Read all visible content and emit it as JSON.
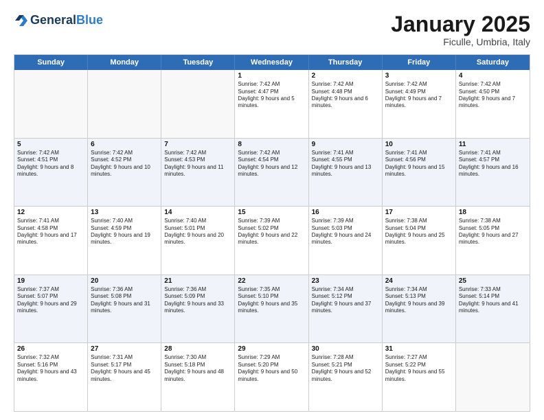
{
  "header": {
    "logo_general": "General",
    "logo_blue": "Blue",
    "month_title": "January 2025",
    "location": "Ficulle, Umbria, Italy"
  },
  "weekdays": [
    "Sunday",
    "Monday",
    "Tuesday",
    "Wednesday",
    "Thursday",
    "Friday",
    "Saturday"
  ],
  "rows": [
    {
      "alt": false,
      "cells": [
        {
          "day": "",
          "text": ""
        },
        {
          "day": "",
          "text": ""
        },
        {
          "day": "",
          "text": ""
        },
        {
          "day": "1",
          "text": "Sunrise: 7:42 AM\nSunset: 4:47 PM\nDaylight: 9 hours and 5 minutes."
        },
        {
          "day": "2",
          "text": "Sunrise: 7:42 AM\nSunset: 4:48 PM\nDaylight: 9 hours and 6 minutes."
        },
        {
          "day": "3",
          "text": "Sunrise: 7:42 AM\nSunset: 4:49 PM\nDaylight: 9 hours and 7 minutes."
        },
        {
          "day": "4",
          "text": "Sunrise: 7:42 AM\nSunset: 4:50 PM\nDaylight: 9 hours and 7 minutes."
        }
      ]
    },
    {
      "alt": true,
      "cells": [
        {
          "day": "5",
          "text": "Sunrise: 7:42 AM\nSunset: 4:51 PM\nDaylight: 9 hours and 8 minutes."
        },
        {
          "day": "6",
          "text": "Sunrise: 7:42 AM\nSunset: 4:52 PM\nDaylight: 9 hours and 10 minutes."
        },
        {
          "day": "7",
          "text": "Sunrise: 7:42 AM\nSunset: 4:53 PM\nDaylight: 9 hours and 11 minutes."
        },
        {
          "day": "8",
          "text": "Sunrise: 7:42 AM\nSunset: 4:54 PM\nDaylight: 9 hours and 12 minutes."
        },
        {
          "day": "9",
          "text": "Sunrise: 7:41 AM\nSunset: 4:55 PM\nDaylight: 9 hours and 13 minutes."
        },
        {
          "day": "10",
          "text": "Sunrise: 7:41 AM\nSunset: 4:56 PM\nDaylight: 9 hours and 15 minutes."
        },
        {
          "day": "11",
          "text": "Sunrise: 7:41 AM\nSunset: 4:57 PM\nDaylight: 9 hours and 16 minutes."
        }
      ]
    },
    {
      "alt": false,
      "cells": [
        {
          "day": "12",
          "text": "Sunrise: 7:41 AM\nSunset: 4:58 PM\nDaylight: 9 hours and 17 minutes."
        },
        {
          "day": "13",
          "text": "Sunrise: 7:40 AM\nSunset: 4:59 PM\nDaylight: 9 hours and 19 minutes."
        },
        {
          "day": "14",
          "text": "Sunrise: 7:40 AM\nSunset: 5:01 PM\nDaylight: 9 hours and 20 minutes."
        },
        {
          "day": "15",
          "text": "Sunrise: 7:39 AM\nSunset: 5:02 PM\nDaylight: 9 hours and 22 minutes."
        },
        {
          "day": "16",
          "text": "Sunrise: 7:39 AM\nSunset: 5:03 PM\nDaylight: 9 hours and 24 minutes."
        },
        {
          "day": "17",
          "text": "Sunrise: 7:38 AM\nSunset: 5:04 PM\nDaylight: 9 hours and 25 minutes."
        },
        {
          "day": "18",
          "text": "Sunrise: 7:38 AM\nSunset: 5:05 PM\nDaylight: 9 hours and 27 minutes."
        }
      ]
    },
    {
      "alt": true,
      "cells": [
        {
          "day": "19",
          "text": "Sunrise: 7:37 AM\nSunset: 5:07 PM\nDaylight: 9 hours and 29 minutes."
        },
        {
          "day": "20",
          "text": "Sunrise: 7:36 AM\nSunset: 5:08 PM\nDaylight: 9 hours and 31 minutes."
        },
        {
          "day": "21",
          "text": "Sunrise: 7:36 AM\nSunset: 5:09 PM\nDaylight: 9 hours and 33 minutes."
        },
        {
          "day": "22",
          "text": "Sunrise: 7:35 AM\nSunset: 5:10 PM\nDaylight: 9 hours and 35 minutes."
        },
        {
          "day": "23",
          "text": "Sunrise: 7:34 AM\nSunset: 5:12 PM\nDaylight: 9 hours and 37 minutes."
        },
        {
          "day": "24",
          "text": "Sunrise: 7:34 AM\nSunset: 5:13 PM\nDaylight: 9 hours and 39 minutes."
        },
        {
          "day": "25",
          "text": "Sunrise: 7:33 AM\nSunset: 5:14 PM\nDaylight: 9 hours and 41 minutes."
        }
      ]
    },
    {
      "alt": false,
      "cells": [
        {
          "day": "26",
          "text": "Sunrise: 7:32 AM\nSunset: 5:16 PM\nDaylight: 9 hours and 43 minutes."
        },
        {
          "day": "27",
          "text": "Sunrise: 7:31 AM\nSunset: 5:17 PM\nDaylight: 9 hours and 45 minutes."
        },
        {
          "day": "28",
          "text": "Sunrise: 7:30 AM\nSunset: 5:18 PM\nDaylight: 9 hours and 48 minutes."
        },
        {
          "day": "29",
          "text": "Sunrise: 7:29 AM\nSunset: 5:20 PM\nDaylight: 9 hours and 50 minutes."
        },
        {
          "day": "30",
          "text": "Sunrise: 7:28 AM\nSunset: 5:21 PM\nDaylight: 9 hours and 52 minutes."
        },
        {
          "day": "31",
          "text": "Sunrise: 7:27 AM\nSunset: 5:22 PM\nDaylight: 9 hours and 55 minutes."
        },
        {
          "day": "",
          "text": ""
        }
      ]
    }
  ]
}
